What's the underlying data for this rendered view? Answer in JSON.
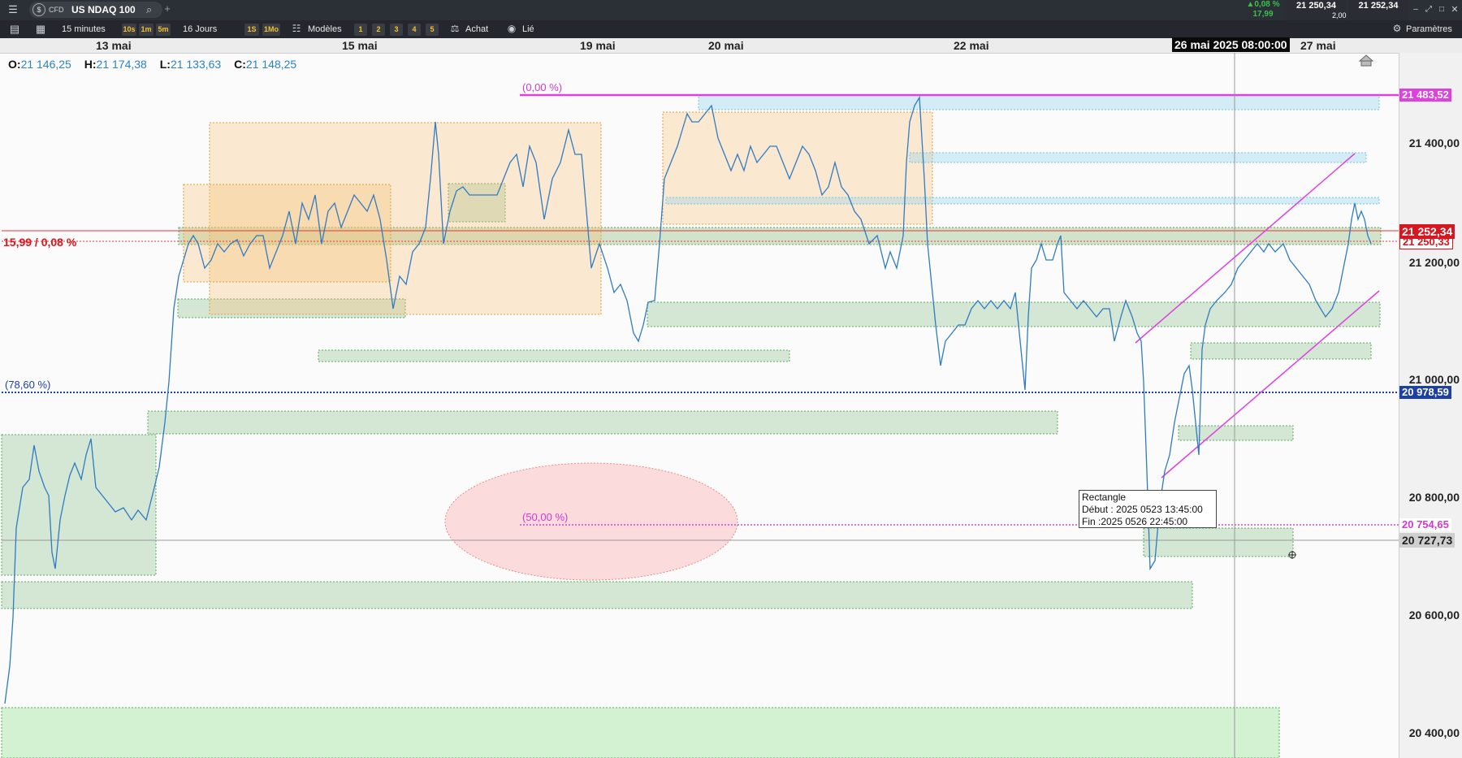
{
  "window": {
    "instrument_type": "CFD",
    "instrument_name": "US NDAQ 100",
    "change_pct": "0,08 %",
    "change_abs": "17,99",
    "bid": "21 250,34",
    "ask": "21 252,34",
    "spread": "2,00"
  },
  "toolbar": {
    "interval": "15 minutes",
    "quick_intervals": [
      "10s",
      "1m",
      "5m"
    ],
    "period": "16 Jours",
    "quick_periods": [
      "1S",
      "1Mo"
    ],
    "models_label": "Modèles",
    "slots": [
      "1",
      "2",
      "3",
      "4",
      "5"
    ],
    "buy_label": "Achat",
    "linked_label": "Lié",
    "settings_label": "Paramètres"
  },
  "date_axis": {
    "labels": [
      "13 mai",
      "15 mai",
      "19 mai",
      "20 mai",
      "22 mai",
      "27 mai"
    ],
    "crosshair_time": "26 mai 2025 08:00:00"
  },
  "ohlc": {
    "o": "21 146,25",
    "h": "21 174,38",
    "l": "21 133,63",
    "c": "21 148,25"
  },
  "price_axis": {
    "ticks": [
      "21 400,00",
      "21 200,00",
      "21 000,00",
      "20 800,00",
      "20 600,00",
      "20 400,00"
    ],
    "label_fib0": "21 483,52",
    "label_current": "21 252,34",
    "label_bid": "21 250,33",
    "label_fib786": "20 978,59",
    "label_fib50": "20 754,65",
    "label_crosshair": "20 727,73"
  },
  "annotations": {
    "fib_0": "(0,00 %)",
    "fib_50": "(50,00 %)",
    "fib_786": "(78,60 %)",
    "change_line": "15,99 / 0,08 %"
  },
  "tooltip": {
    "title": "Rectangle",
    "start": "Début : 2025 0523 13:45:00",
    "end": "Fin :2025 0526 22:45:00"
  },
  "colors": {
    "accent_green": "#3cc04a",
    "price_red": "#d7171f",
    "fib_magenta": "#e040e0",
    "fib_blue": "#1c3fa8",
    "candle_blue": "#2f7bc4"
  }
}
